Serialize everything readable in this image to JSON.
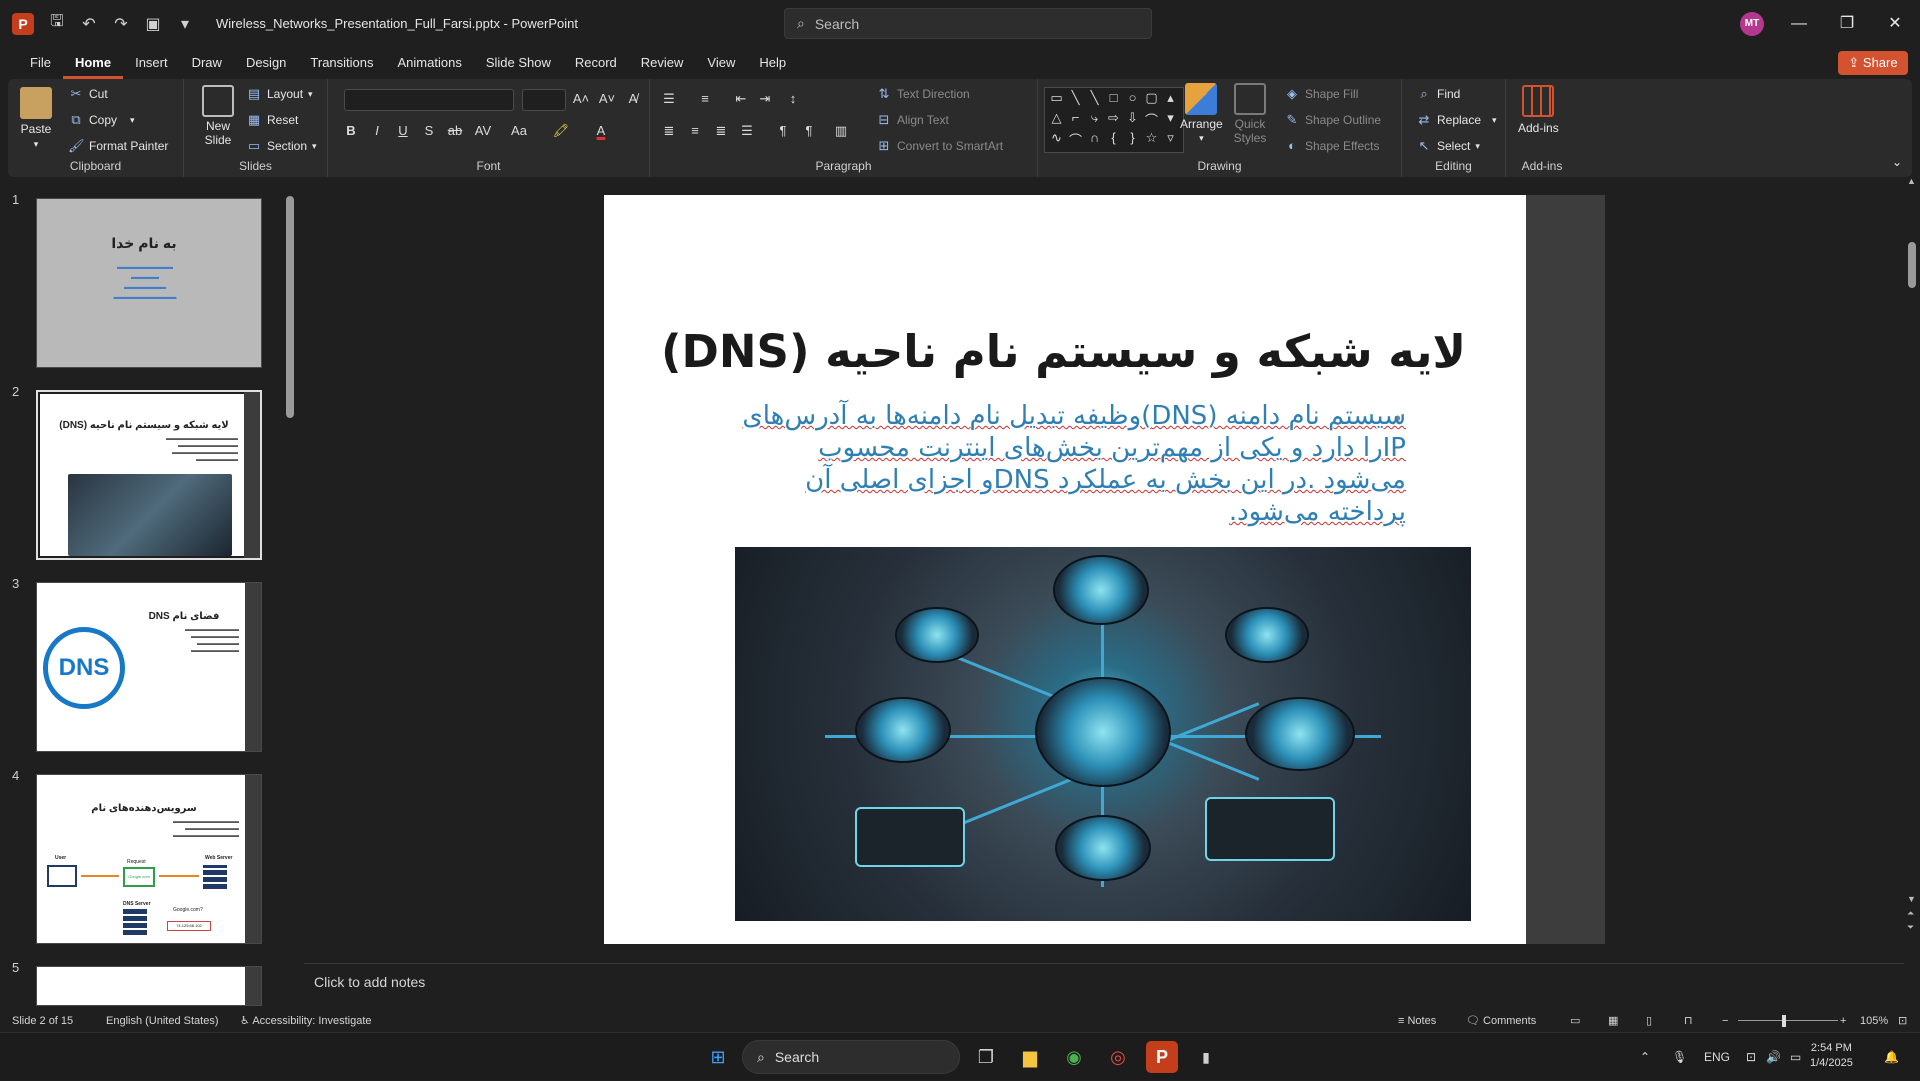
{
  "window": {
    "app_icon": "P",
    "doc_title": "Wireless_Networks_Presentation_Full_Farsi.pptx  -  PowerPoint",
    "search_placeholder": "Search",
    "avatar_initials": "MT"
  },
  "menu": {
    "tabs": [
      "File",
      "Home",
      "Insert",
      "Draw",
      "Design",
      "Transitions",
      "Animations",
      "Slide Show",
      "Record",
      "Review",
      "View",
      "Help"
    ],
    "active": "Home",
    "share_label": "Share"
  },
  "ribbon": {
    "clipboard": {
      "label": "Clipboard",
      "paste": "Paste",
      "cut": "Cut",
      "copy": "Copy",
      "format_painter": "Format Painter"
    },
    "slides": {
      "label": "Slides",
      "new_slide": "New Slide",
      "layout": "Layout",
      "reset": "Reset",
      "section": "Section"
    },
    "font": {
      "label": "Font"
    },
    "paragraph": {
      "label": "Paragraph",
      "text_direction": "Text Direction",
      "align_text": "Align Text",
      "convert_smartart": "Convert to SmartArt"
    },
    "drawing": {
      "label": "Drawing",
      "arrange": "Arrange",
      "quick_styles": "Quick Styles",
      "shape_fill": "Shape Fill",
      "shape_outline": "Shape Outline",
      "shape_effects": "Shape Effects"
    },
    "editing": {
      "label": "Editing",
      "find": "Find",
      "replace": "Replace",
      "select": "Select"
    },
    "addins": {
      "label": "Add-ins",
      "addins": "Add-ins"
    }
  },
  "thumbnails": [
    {
      "num": "1",
      "title": "به نام خدا"
    },
    {
      "num": "2",
      "title": "لایه شبکه و سیستم نام ناحیه (DNS)"
    },
    {
      "num": "3",
      "title": "فضای نام DNS",
      "globe": "DNS"
    },
    {
      "num": "4",
      "title": "سرویس‌دهنده‌های نام",
      "labels": [
        "User",
        "Request",
        "Web Server",
        "Google.com",
        "DNS Server",
        "Google.com?",
        "74.125.68.102"
      ]
    },
    {
      "num": "5",
      "title": ""
    }
  ],
  "slide": {
    "title": "لایه شبکه و سیستم نام ناحیه (DNS)",
    "bullet": "سیستم نام دامنه (DNS)وظیفه تبدیل نام دامنه‌ها به آدرس‌های IPرا دارد و یکی از مهم‌ترین بخش‌های اینترنت محسوب می‌شود .در این بخش به عملکرد DNSو اجزای اصلی آن پرداخته می‌شود."
  },
  "notes": {
    "placeholder": "Click to add notes"
  },
  "status": {
    "slide_info": "Slide 2 of 15",
    "language": "English (United States)",
    "accessibility": "Accessibility: Investigate",
    "notes": "Notes",
    "comments": "Comments",
    "zoom": "105%"
  },
  "taskbar": {
    "search": "Search",
    "lang": "ENG",
    "time": "2:54 PM",
    "date": "1/4/2025"
  },
  "colors": {
    "accent": "#d35230",
    "bullet_text": "#2f7fb5"
  }
}
